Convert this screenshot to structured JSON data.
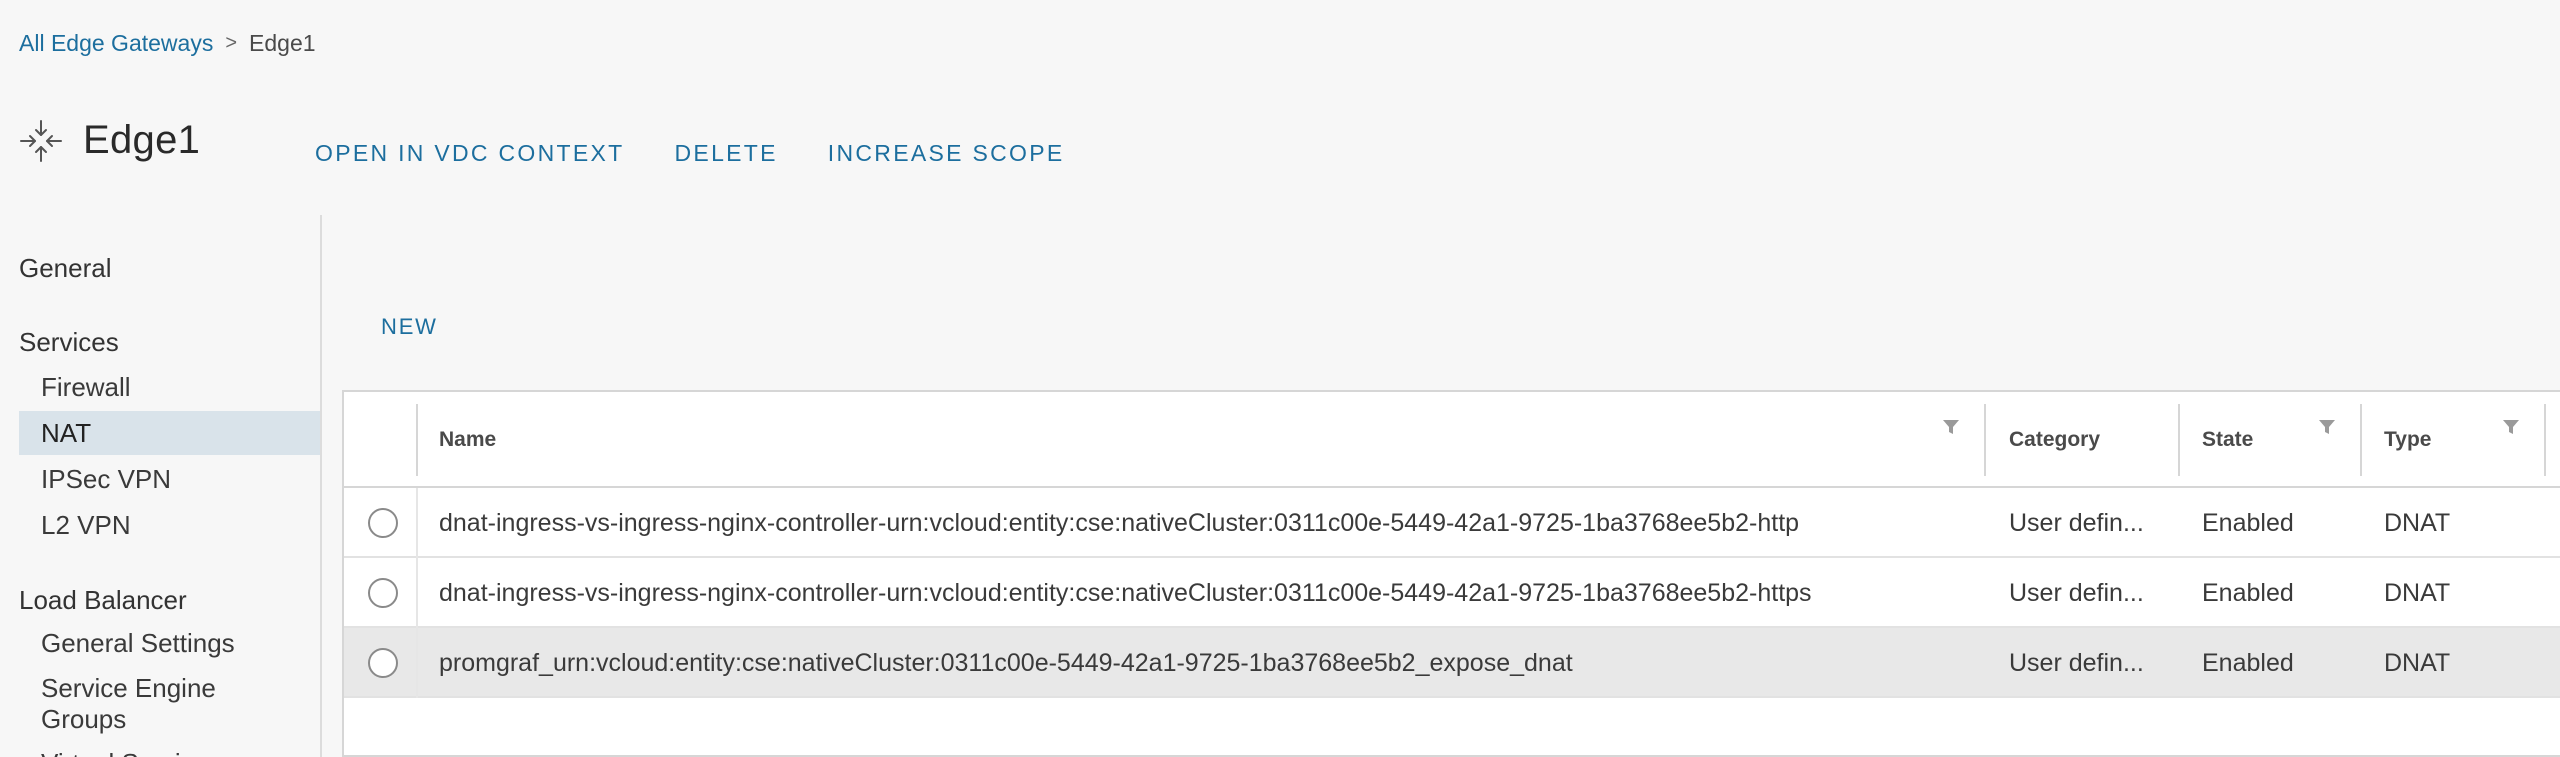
{
  "breadcrumb": {
    "parent": "All Edge Gateways",
    "separator": ">",
    "current": "Edge1"
  },
  "header": {
    "title": "Edge1",
    "icon": "edge-gateway-arrows-icon",
    "actions": [
      "OPEN IN VDC CONTEXT",
      "DELETE",
      "INCREASE SCOPE"
    ]
  },
  "sidebar": {
    "general": "General",
    "services": {
      "label": "Services",
      "items": [
        "Firewall",
        "NAT",
        "IPSec VPN",
        "L2 VPN"
      ],
      "active": "NAT"
    },
    "load_balancer": {
      "label": "Load Balancer",
      "items": [
        "General Settings",
        "Service Engine Groups",
        "Virtual Services"
      ]
    }
  },
  "toolbar": {
    "new_label": "NEW"
  },
  "grid": {
    "columns": [
      "Name",
      "Category",
      "State",
      "Type"
    ],
    "rows": [
      {
        "name": "dnat-ingress-vs-ingress-nginx-controller-urn:vcloud:entity:cse:nativeCluster:0311c00e-5449-42a1-9725-1ba3768ee5b2-http",
        "category": "User defin...",
        "state": "Enabled",
        "type": "DNAT",
        "selected": false
      },
      {
        "name": "dnat-ingress-vs-ingress-nginx-controller-urn:vcloud:entity:cse:nativeCluster:0311c00e-5449-42a1-9725-1ba3768ee5b2-https",
        "category": "User defin...",
        "state": "Enabled",
        "type": "DNAT",
        "selected": false
      },
      {
        "name": "promgraf_urn:vcloud:entity:cse:nativeCluster:0311c00e-5449-42a1-9725-1ba3768ee5b2_expose_dnat",
        "category": "User defin...",
        "state": "Enabled",
        "type": "DNAT",
        "selected": false,
        "highlighted": true
      }
    ]
  },
  "colors": {
    "link": "#1c6e9e",
    "active_nav_bg": "#d9e3ea",
    "highlighted_row_bg": "#e8e8e8"
  }
}
